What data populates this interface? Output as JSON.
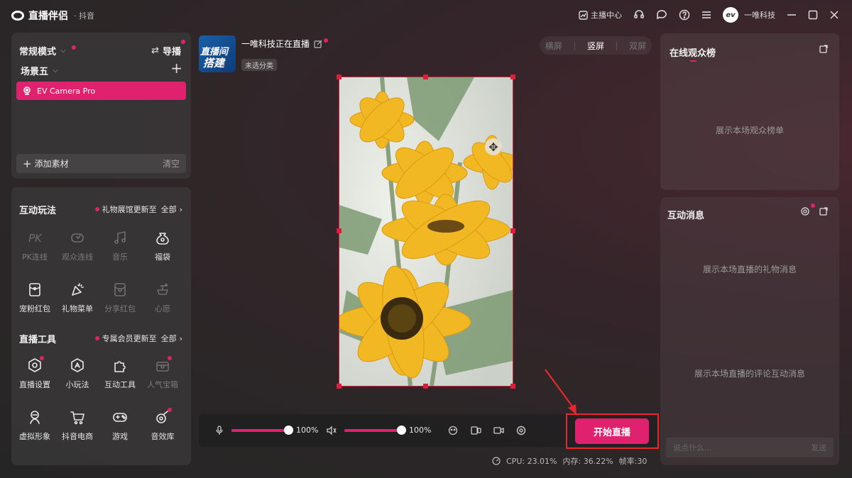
{
  "app": {
    "name": "直播伴侣",
    "platform": "· 抖音"
  },
  "topbar": {
    "anchor_center": "主播中心",
    "user_name": "一唯科技",
    "avatar_text": "ev"
  },
  "left": {
    "mode_label": "常规模式",
    "guide_label": "导播",
    "scene_label": "场景五",
    "source_name": "EV Camera Pro",
    "add_source": "添加素材",
    "clear": "清空"
  },
  "interactive": {
    "title": "互动玩法",
    "update_note": "礼物展馆更新至",
    "all": "全部",
    "items": [
      {
        "label": "PK连线",
        "icon": "pk-icon",
        "enabled": false
      },
      {
        "label": "观众连线",
        "icon": "audience-link-icon",
        "enabled": false
      },
      {
        "label": "音乐",
        "icon": "music-icon",
        "enabled": false
      },
      {
        "label": "福袋",
        "icon": "lucky-bag-icon",
        "enabled": true
      },
      {
        "label": "宠粉红包",
        "icon": "red-packet-icon",
        "enabled": true
      },
      {
        "label": "礼物菜单",
        "icon": "gift-menu-icon",
        "enabled": true
      },
      {
        "label": "分享红包",
        "icon": "share-packet-icon",
        "enabled": false
      },
      {
        "label": "心愿",
        "icon": "wish-icon",
        "enabled": false
      }
    ]
  },
  "tools": {
    "title": "直播工具",
    "update_note": "专属会员更新至",
    "all": "全部",
    "items": [
      {
        "label": "直播设置",
        "icon": "live-settings-icon",
        "enabled": true
      },
      {
        "label": "小玩法",
        "icon": "mini-game-icon",
        "enabled": true
      },
      {
        "label": "互动工具",
        "icon": "puzzle-icon",
        "enabled": true
      },
      {
        "label": "人气宝箱",
        "icon": "treasure-box-icon",
        "enabled": false
      },
      {
        "label": "虚拟形象",
        "icon": "avatar-figure-icon",
        "enabled": true
      },
      {
        "label": "抖音电商",
        "icon": "cart-icon",
        "enabled": true
      },
      {
        "label": "游戏",
        "icon": "gamepad-icon",
        "enabled": true
      },
      {
        "label": "音效库",
        "icon": "sound-effect-icon",
        "enabled": true
      }
    ]
  },
  "stream": {
    "cover_line1": "直播间",
    "cover_line2": "搭建",
    "title": "一唯科技正在直播",
    "category": "未选分类"
  },
  "orientation": {
    "landscape": "横屏",
    "portrait": "竖屏",
    "dual": "双屏",
    "active": "portrait"
  },
  "controls": {
    "mic_volume": "100%",
    "speaker_volume": "100%",
    "mic_level": 1.0,
    "speaker_level": 1.0,
    "start_label": "开始直播"
  },
  "stats": {
    "cpu": "CPU: 23.01%",
    "mem": "内存: 36.22%",
    "fps": "帧率:30"
  },
  "audience": {
    "title": "在线观众榜",
    "empty": "展示本场观众榜单"
  },
  "messages": {
    "title": "互动消息",
    "gift_empty": "展示本场直播的礼物消息",
    "comment_empty": "展示本场直播的评论互动消息",
    "placeholder": "说点什么...",
    "send": "发送"
  },
  "colors": {
    "accent": "#e0226e",
    "highlight_box": "#e8262e"
  }
}
